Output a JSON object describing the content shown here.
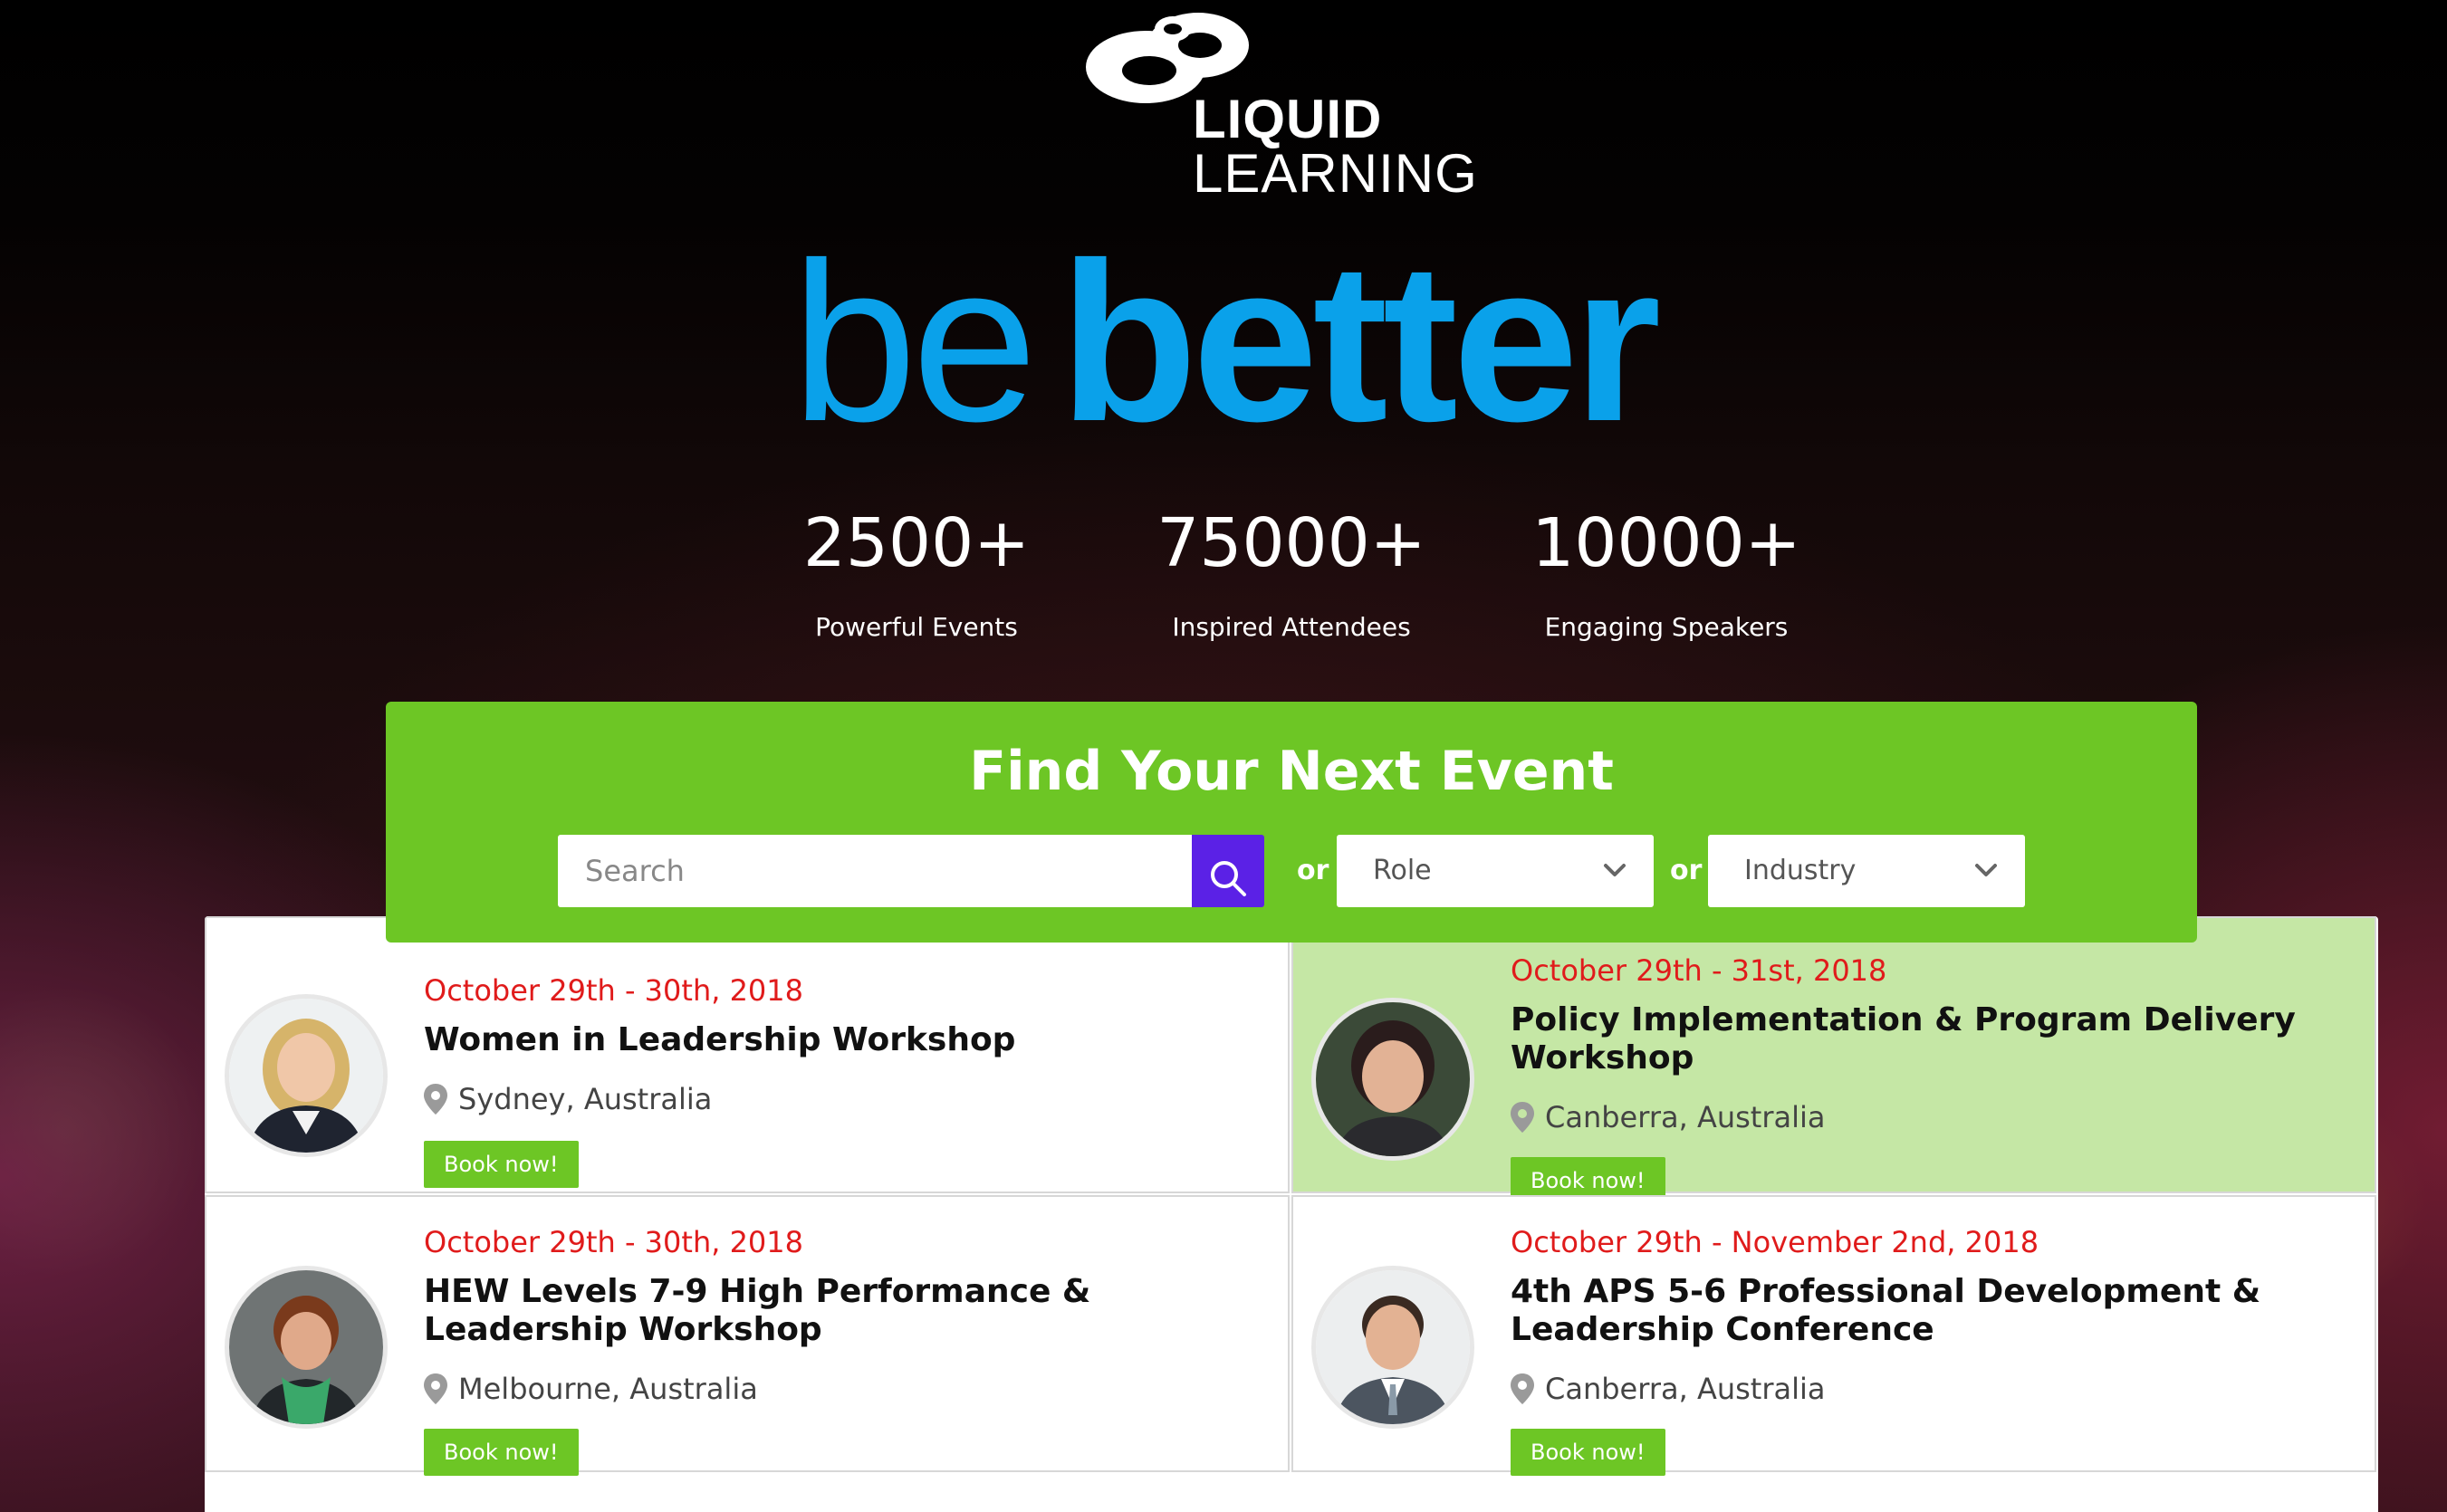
{
  "brand": {
    "line1": "LIQUID",
    "line2": "LEARNING"
  },
  "tagline": {
    "light": "be",
    "bold": "better"
  },
  "stats": [
    {
      "value": "2500+",
      "label": "Powerful Events"
    },
    {
      "value": "75000+",
      "label": "Inspired Attendees"
    },
    {
      "value": "10000+",
      "label": "Engaging Speakers"
    }
  ],
  "finder": {
    "title": "Find Your Next Event",
    "search_placeholder": "Search",
    "or": "or",
    "role_label": "Role",
    "industry_label": "Industry"
  },
  "events": [
    {
      "date": "October 29th - 30th, 2018",
      "title": "Women in Leadership Workshop",
      "location": "Sydney, Australia",
      "cta": "Book now!",
      "featured": false,
      "avatar": "speaker-blonde-woman"
    },
    {
      "date": "October 29th - 31st, 2018",
      "title": "Policy Implementation & Program Delivery Workshop",
      "location": "Canberra, Australia",
      "cta": "Book now!",
      "featured": true,
      "avatar": "speaker-dark-haired-woman"
    },
    {
      "date": "October 29th - 30th, 2018",
      "title": "HEW Levels 7-9 High Performance & Leadership Workshop",
      "location": "Melbourne, Australia",
      "cta": "Book now!",
      "featured": false,
      "avatar": "speaker-woman-green-scarf"
    },
    {
      "date": "October 29th - November 2nd, 2018",
      "title": "4th APS 5-6 Professional Development & Leadership Conference",
      "location": "Canberra, Australia",
      "cta": "Book now!",
      "featured": false,
      "avatar": "speaker-man-suit"
    }
  ],
  "colors": {
    "accent_blue": "#0aa1ea",
    "brand_green": "#6dc625",
    "featured_green": "#c5e7a5",
    "search_purple": "#5b21e6",
    "date_red": "#e01b1b"
  }
}
